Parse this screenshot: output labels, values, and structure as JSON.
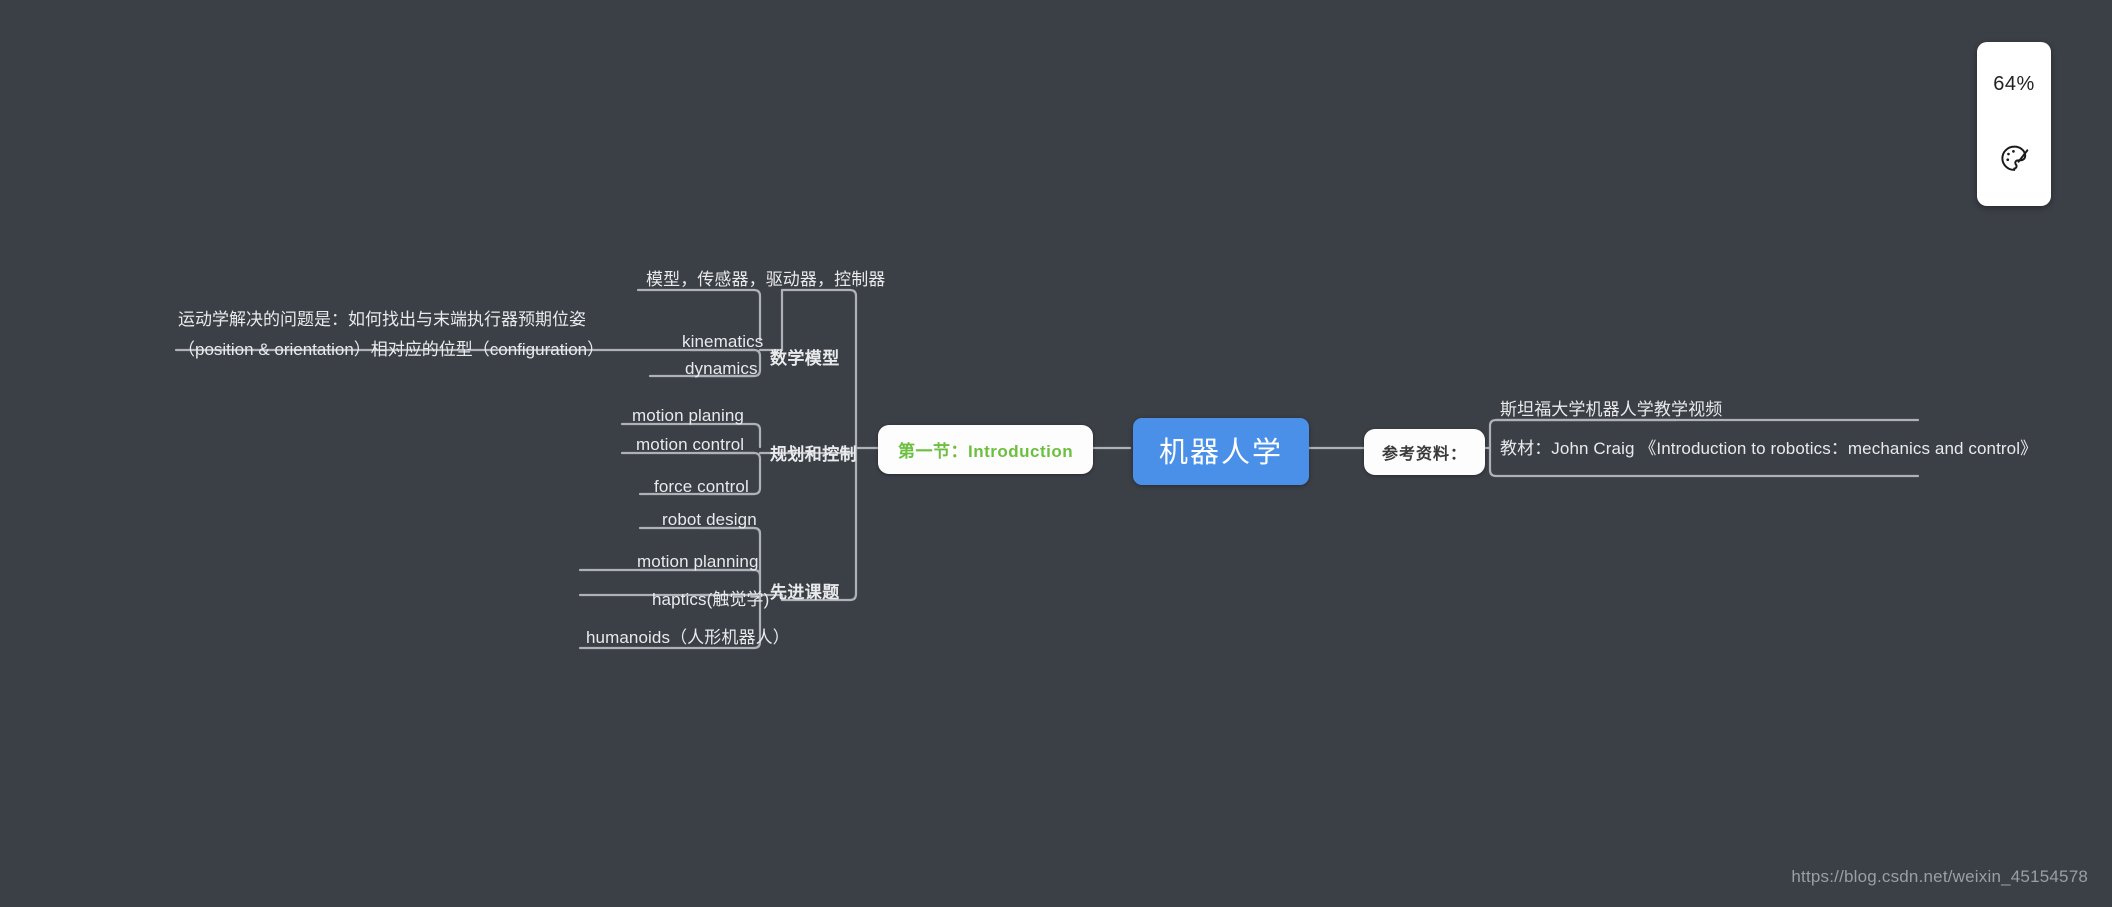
{
  "app": {
    "background_color": "#3b3f46",
    "accent_color": "#4a90e8",
    "chapter_color": "#6cbf3f",
    "line_color": "#aeb2b8",
    "text_color": "#e9eaec"
  },
  "mindmap": {
    "root": {
      "label": "机器人学"
    },
    "left_branch": {
      "chapter": {
        "label": "第一节：Introduction"
      },
      "groups": [
        {
          "label": "数学模型",
          "items": [
            {
              "label": "模型，传感器，驱动器，控制器"
            },
            {
              "label": "kinematics"
            },
            {
              "label": "dynamics"
            }
          ],
          "note": "运动学解决的问题是：如何找出与末端执行器预期位姿（position & orientation）相对应的位型（configuration）"
        },
        {
          "label": "规划和控制",
          "items": [
            {
              "label": "motion planing"
            },
            {
              "label": "motion control"
            },
            {
              "label": "force control"
            }
          ]
        },
        {
          "label": "先进课题",
          "items": [
            {
              "label": "robot design"
            },
            {
              "label": "motion planning"
            },
            {
              "label": "haptics(触觉学)"
            },
            {
              "label": "humanoids（人形机器人）"
            }
          ]
        }
      ]
    },
    "right_branch": {
      "label": "参考资料：",
      "items": [
        {
          "label": "斯坦福大学机器人学教学视频"
        },
        {
          "label": "教材：John Craig 《Introduction to robotics：mechanics and control》"
        }
      ]
    }
  },
  "zoom_widget": {
    "percent": "64%",
    "palette_icon": "palette-icon"
  },
  "watermark": {
    "text": "https://blog.csdn.net/weixin_45154578"
  }
}
